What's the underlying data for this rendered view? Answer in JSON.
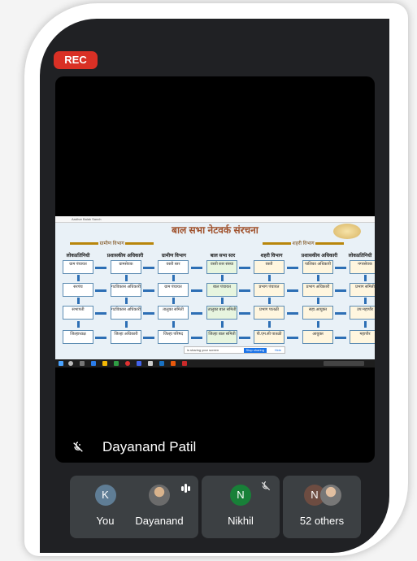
{
  "badge": {
    "rec": "REC"
  },
  "shared_screen": {
    "browser_tab": "Aadhar Balak Sanch",
    "title": "बाल सभा नेटवर्क संरचना",
    "left_banner": "ग्रामीण विभाग",
    "right_banner": "शहरी विभाग",
    "column_headers": [
      "लोकप्रतिनिधी",
      "प्रशासकीय अधिकारी",
      "ग्रामीण विभाग",
      "बाल सभा स्तर",
      "शहरी विभाग",
      "प्रशासकीय अधिकारी",
      "लोकप्रतिनिधी"
    ],
    "columns": [
      [
        "ग्राम पंचायत",
        "सरपंच",
        "सभापती",
        "जिल्हाध्यक्ष"
      ],
      [
        "ग्रामसेवक",
        "गटविकास अधिकारी",
        "गटविकास अधिकारी",
        "जिल्हा अधिकारी"
      ],
      [
        "वस्ती स्तर",
        "ग्राम पंचायत",
        "तालुका समिती",
        "जिल्हा परिषद"
      ],
      [
        "वस्ती स्तर संस्था",
        "बाल पंचायत",
        "तालुका बाल समिती",
        "जिल्हा बाल समिती"
      ],
      [
        "वस्ती",
        "प्रभाग पंचायत",
        "प्रभाग पातळी",
        "पी.एम.सी पातळी"
      ],
      [
        "पालिका अधिकारी",
        "प्रभाग अधिकारी",
        "सहा.आयुक्त",
        "आयुक्त"
      ],
      [
        "नगरसेवक",
        "प्रभाग समिती",
        "उप महापौर",
        "महापौर"
      ]
    ],
    "screen_share_notice": "is sharing your screen",
    "stop_sharing": "Stop sharing",
    "hide": "Hide"
  },
  "active_speaker": {
    "name": "Dayanand Patil",
    "mic_state": "muted"
  },
  "participants": [
    {
      "initial": "K",
      "label": "You",
      "avatar_color": "#5f7d95",
      "mic_state": "muted"
    },
    {
      "initial": "",
      "label": "Dayanand",
      "avatar_color": "#8a8a8a",
      "mic_state": "speaking"
    },
    {
      "initial": "N",
      "label": "Nikhil",
      "avatar_color": "#188038",
      "mic_state": "muted"
    },
    {
      "initial": "N",
      "label": "52 others",
      "avatar_color": "#6d4c41",
      "mic_state": "none"
    }
  ],
  "colors": {
    "rec": "#d93025",
    "tile_bg": "#3c4043",
    "background": "#202124"
  }
}
